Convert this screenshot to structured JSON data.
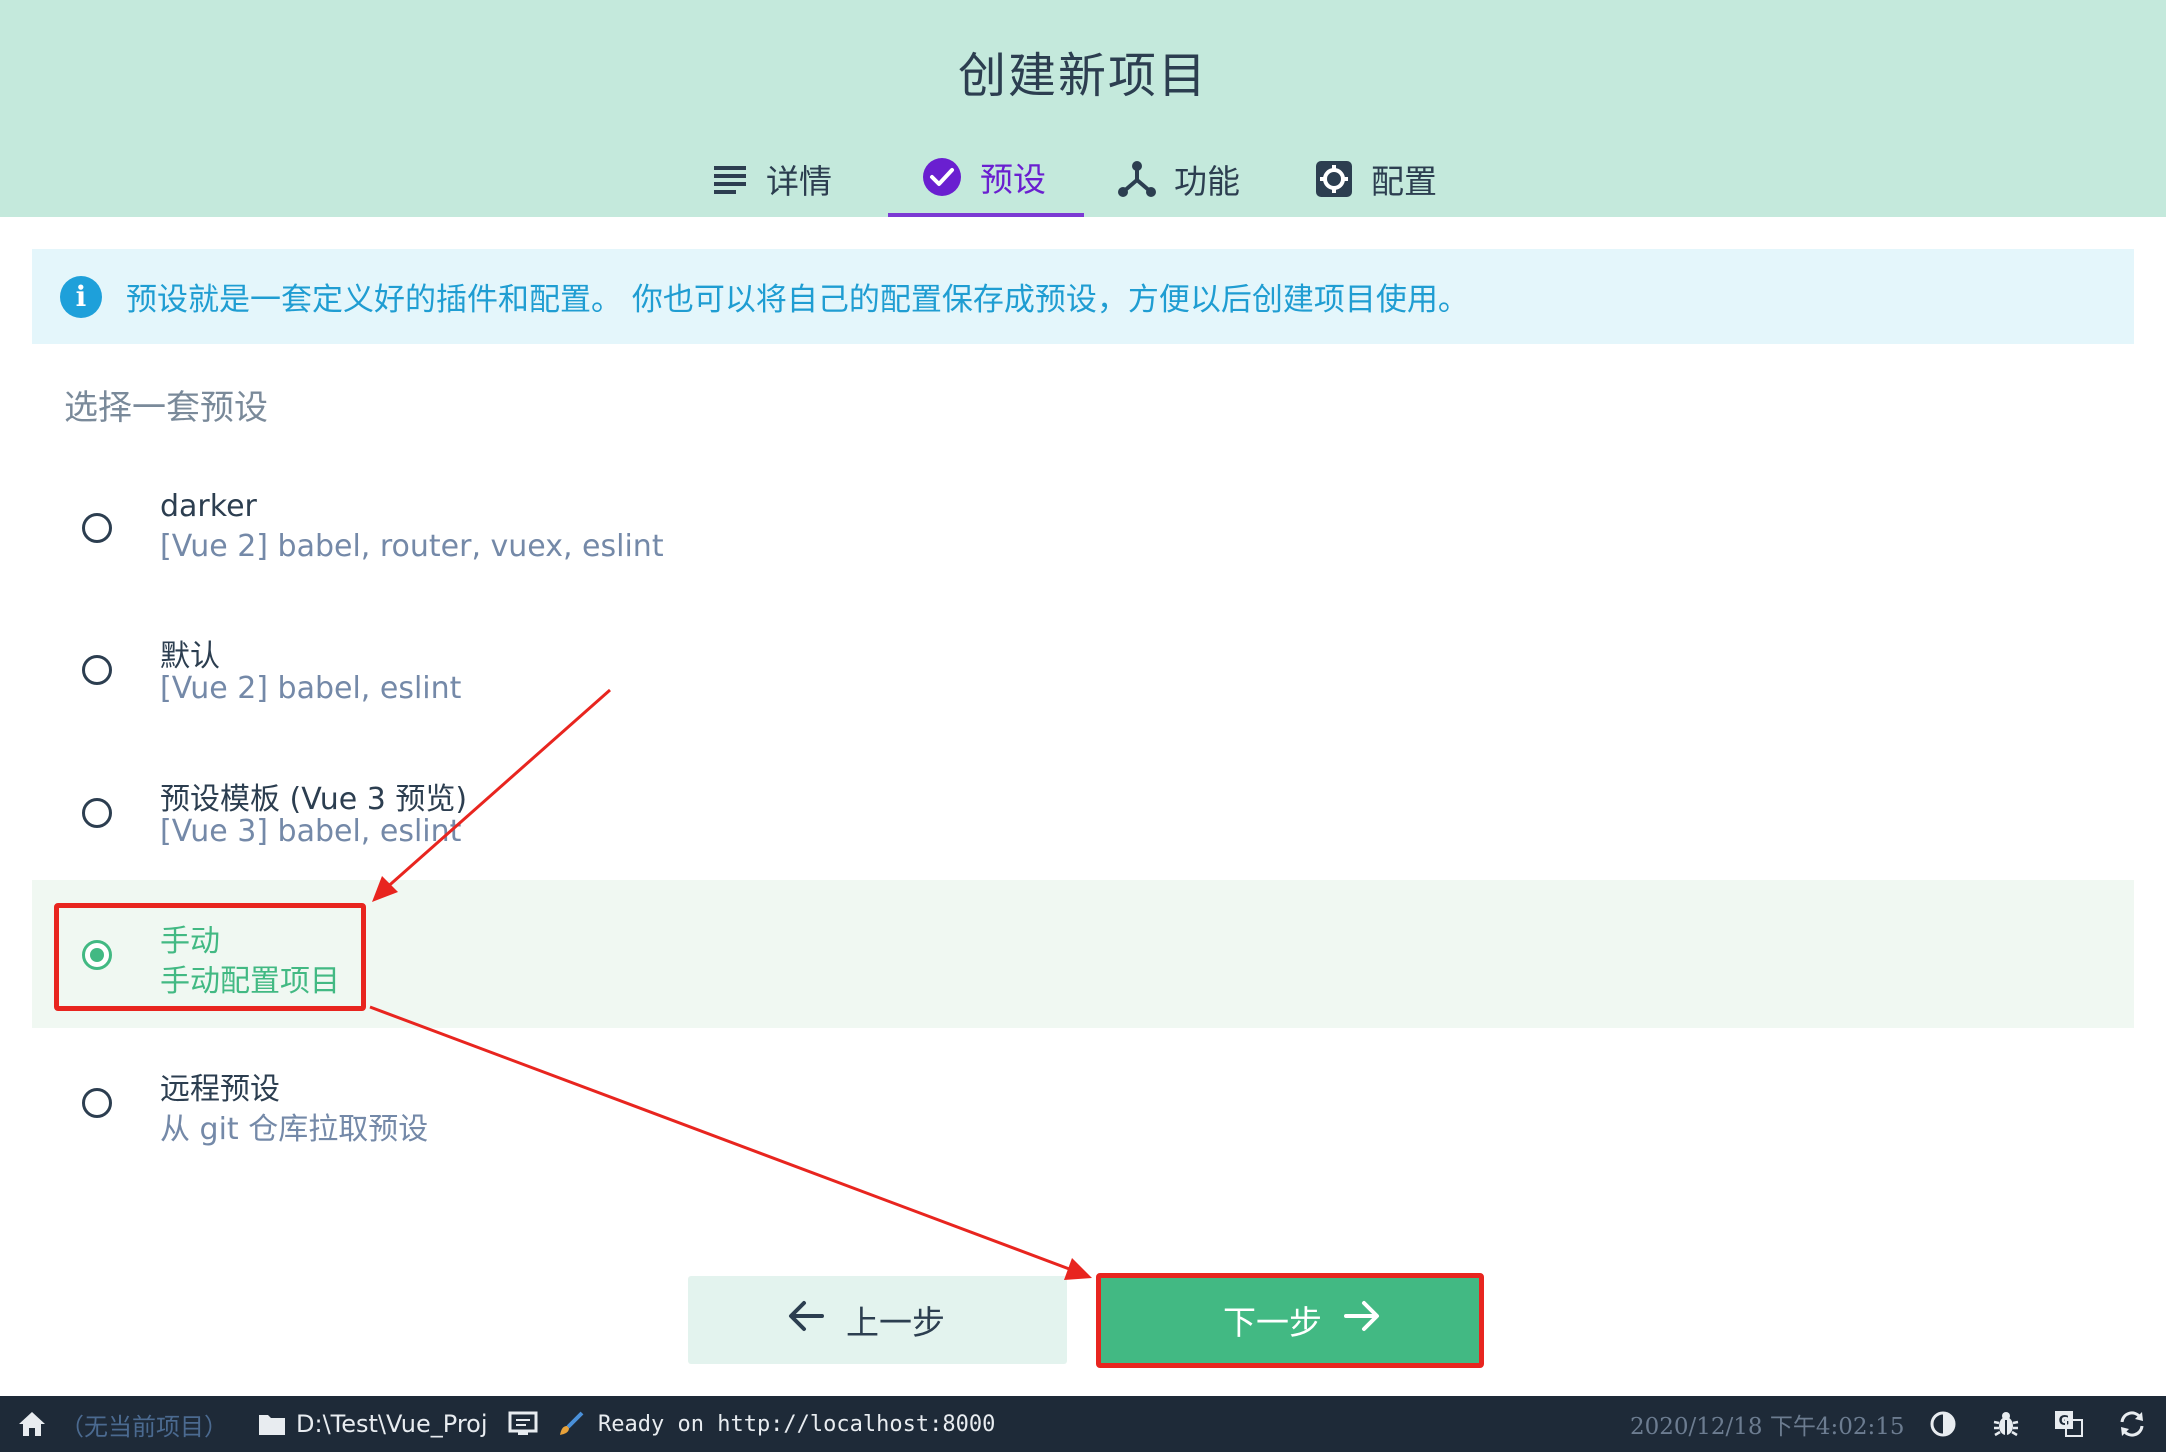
{
  "header": {
    "title": "创建新项目",
    "tabs": [
      {
        "label": "详情",
        "icon": "list-icon"
      },
      {
        "label": "预设",
        "icon": "check-circle-icon",
        "active": true
      },
      {
        "label": "功能",
        "icon": "fork-icon"
      },
      {
        "label": "配置",
        "icon": "gear-icon"
      }
    ]
  },
  "info": {
    "text": "预设就是一套定义好的插件和配置。 你也可以将自己的配置保存成预设，方便以后创建项目使用。"
  },
  "section_title": "选择一套预设",
  "presets": [
    {
      "name": "darker",
      "desc": "[Vue 2] babel, router, vuex, eslint",
      "selected": false
    },
    {
      "name": "默认",
      "desc": "[Vue 2] babel, eslint",
      "selected": false
    },
    {
      "name": "预设模板 (Vue 3 预览)",
      "desc": "[Vue 3] babel, eslint",
      "selected": false
    },
    {
      "name": "手动",
      "desc": "手动配置项目",
      "selected": true
    },
    {
      "name": "远程预设",
      "desc": "从 git 仓库拉取预设",
      "selected": false
    }
  ],
  "buttons": {
    "prev_label": "上一步",
    "next_label": "下一步"
  },
  "statusbar": {
    "no_project": "（无当前项目）",
    "path": "D:\\Test\\Vue_Proj",
    "log": "Ready on http://localhost:8000",
    "time": "2020/12/18 下午4:02:15"
  },
  "colors": {
    "header_bg": "#c4e9dc",
    "accent_green": "#42b983",
    "tab_active": "#6a1fd0",
    "annotation_red": "#e8251f"
  }
}
